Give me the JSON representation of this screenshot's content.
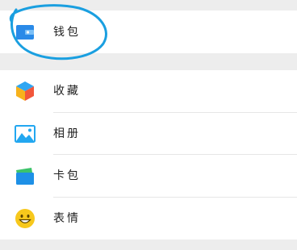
{
  "menu": {
    "wallet": {
      "label": "钱包",
      "icon": "wallet-icon"
    },
    "items": [
      {
        "label": "收藏",
        "icon": "favorites-cube-icon"
      },
      {
        "label": "相册",
        "icon": "photo-album-icon"
      },
      {
        "label": "卡包",
        "icon": "card-pack-icon"
      },
      {
        "label": "表情",
        "icon": "emoji-smile-icon"
      }
    ]
  },
  "colors": {
    "background": "#ededed",
    "row": "#ffffff",
    "annotation": "#1a9fe0",
    "wallet_icon": "#2a8ae8",
    "album_icon": "#22a7f0",
    "card_icon": "#1e90e6",
    "emoji_icon": "#f7c81c"
  }
}
